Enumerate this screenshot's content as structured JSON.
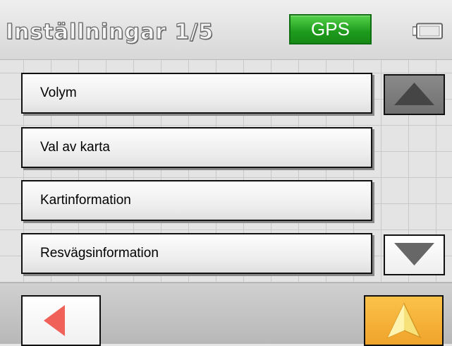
{
  "header": {
    "title": "Inställningar 1/5",
    "gps_label": "GPS",
    "battery_icon": "battery-icon"
  },
  "menu": {
    "items": [
      {
        "label": "Volym"
      },
      {
        "label": "Val av karta"
      },
      {
        "label": "Kartinformation"
      },
      {
        "label": "Resvägsinformation"
      }
    ]
  },
  "scroll": {
    "up_icon": "triangle-up-icon",
    "down_icon": "triangle-down-icon"
  },
  "footer": {
    "back_icon": "arrow-left-icon",
    "navigate_icon": "navigation-arrow-icon"
  },
  "colors": {
    "gps_green": "#1d9a1c",
    "back_arrow_red": "#f0615a",
    "nav_button_orange": "#f0a32b",
    "nav_arrow_yellow": "#f7e27a"
  }
}
